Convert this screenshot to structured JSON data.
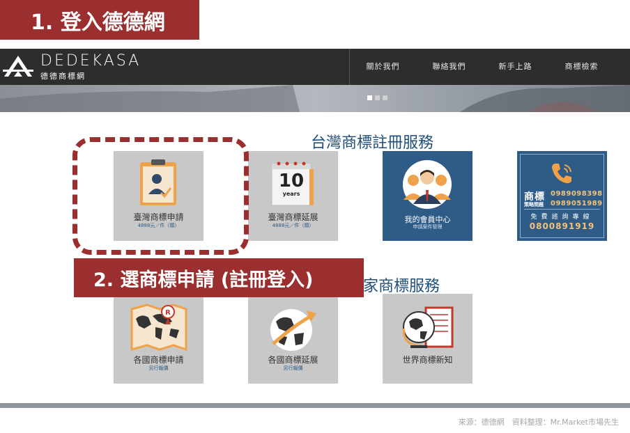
{
  "steps": {
    "step1": "1. 登入德德網",
    "step2": "2. 選商標申請 (註冊登入)"
  },
  "site": {
    "brand_en": "DEDEKASA",
    "brand_zh": "德德商標網"
  },
  "nav": {
    "items": [
      "關於我們",
      "聯絡我們",
      "新手上路",
      "商標檢索"
    ]
  },
  "sections": {
    "taiwan_title": "台灣商標註冊服務",
    "intl_title_visible": "家商標服務"
  },
  "cards": {
    "tw_apply": {
      "title": "臺灣商標申請",
      "sub": "4888元／件（類）"
    },
    "tw_renew": {
      "title": "臺灣商標延展",
      "sub": "4888元／件（類）",
      "calendar_num": "10",
      "calendar_word": "years"
    },
    "member": {
      "title": "我的會員中心",
      "sub": "申請案件管理"
    },
    "intl_apply": {
      "title": "各國商標申請",
      "sub": "另行報價"
    },
    "intl_renew": {
      "title": "各國商標延展",
      "sub": "另行報價"
    },
    "world_news": {
      "title": "世界商標新知"
    }
  },
  "contact": {
    "brand": "商標",
    "brand_sub": "策略問題",
    "phone1": "0989098398",
    "phone2": "0989051989",
    "free_consult": "免費諮詢專線",
    "tollfree": "0800891919"
  },
  "footer": {
    "source": "來源：德德網　資料整理：Mr.Market市場先生"
  },
  "colors": {
    "accent_red": "#9b2e2e",
    "nav_bg": "#2d2d2d",
    "card_gray": "#c8c8c8",
    "card_blue": "#2e5c86",
    "title_blue": "#1f4e79"
  }
}
